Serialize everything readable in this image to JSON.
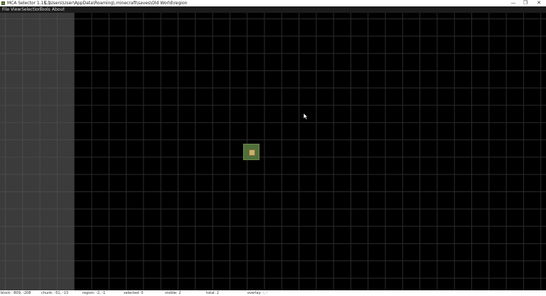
{
  "window": {
    "title": "MCA Selector 1.15.1",
    "path": "C:\\Users\\User\\AppData\\Roaming\\.minecraft\\saves\\Old World\\region",
    "minimize_glyph": "—",
    "maximize_glyph": "❐",
    "close_glyph": "✕"
  },
  "menu": {
    "file": "File",
    "view": "View",
    "selection": "Selection",
    "tools": "Tools",
    "about": "About"
  },
  "status": {
    "block": "block: -809, -208",
    "chunk": "chunk: -51, -13",
    "region": "region: -2, -1",
    "selected": "selected: 0",
    "visible": "visible: 2",
    "total": "total: 2",
    "overlay": "overlay: -, -"
  },
  "colors": {
    "map_background": "#000000",
    "grid_line": "#2c2c2c",
    "void_area": "#3b3b3b",
    "region_tile": "#4f6f3a"
  }
}
